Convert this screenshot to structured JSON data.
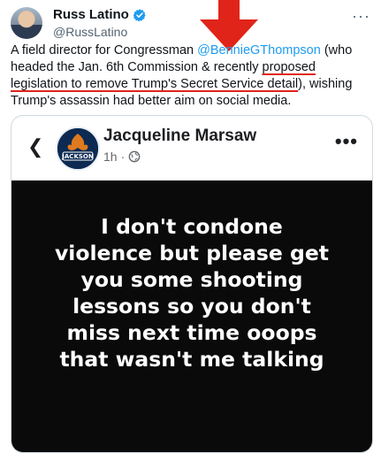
{
  "tweet": {
    "author_name": "Russ Latino",
    "author_handle": "@RussLatino",
    "text_before": "A field director for Congressman ",
    "mention": "@BennieGThompson",
    "text_middle": " (who headed the Jan. 6th Commission & recently ",
    "underlined": "proposed legislation to remove Trump's Secret Service detail",
    "text_after": "), wishing Trump's assassin had better aim on social media.",
    "more_icon": "more-horizontal-icon",
    "verified_icon": "verified-badge-icon"
  },
  "embedded_post": {
    "author_name": "Jacqueline Marsaw",
    "avatar_text": "JACKSON",
    "time": "1h",
    "visibility_icon": "globe-icon",
    "back_icon": "chevron-left-icon",
    "more_icon": "more-horizontal-icon",
    "text": "I don't condone\nviolence but please get\nyou some  shooting\nlessons so you don't\nmiss next time ooops\nthat wasn't me talking"
  },
  "colors": {
    "accent": "#1d9bf0",
    "annotation": "#e0241a",
    "post_background": "#0a0a0a"
  }
}
